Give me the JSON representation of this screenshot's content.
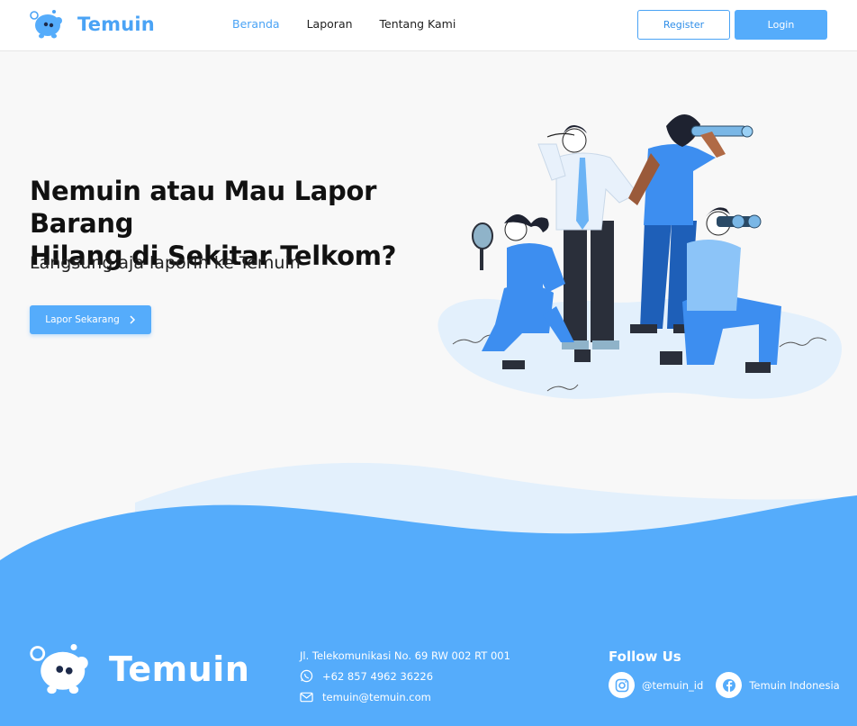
{
  "navbar": {
    "brand": "Temuin",
    "links": [
      {
        "label": "Beranda"
      },
      {
        "label": "Laporan"
      },
      {
        "label": "Tentang Kami"
      }
    ],
    "register_label": "Register",
    "login_label": "Login"
  },
  "hero": {
    "title_line1": "Nemuin atau Mau Lapor Barang",
    "title_line2": "Hilang di Sekitar Telkom?",
    "subtitle": "Langsung aja laporin ke Temuin",
    "cta_label": "Lapor Sekarang",
    "cta_icon": "chevron-right-icon"
  },
  "footer": {
    "brand": "Temuin",
    "address": "Jl. Telekomunikasi No. 69 RW 002 RT 001",
    "phone": "+62 857 4962 36226",
    "email": "temuin@temuin.com",
    "follow_title": "Follow Us",
    "instagram": "@temuin_id",
    "facebook": "Temuin Indonesia"
  },
  "colors": {
    "primary": "#55acfb",
    "primary_dark": "#2f8ee8",
    "wave_light": "#e3f0fc",
    "background": "#f8f8f8"
  }
}
